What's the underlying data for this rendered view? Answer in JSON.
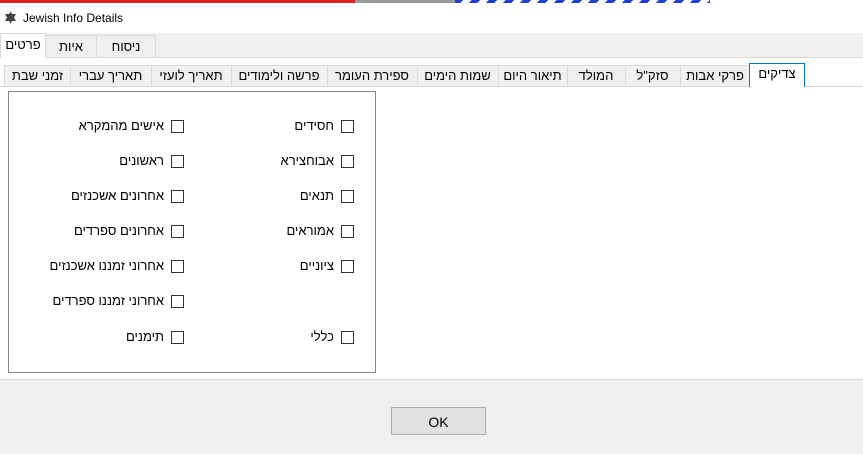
{
  "window": {
    "title": "Jewish Info Details",
    "icon": "star-of-david-icon"
  },
  "outer_tabs": [
    {
      "label": "פרטים",
      "active": true
    },
    {
      "label": "איות",
      "active": false
    },
    {
      "label": "ניסוח",
      "active": false
    }
  ],
  "inner_tabs": [
    {
      "label": "צדיקים",
      "active": true
    },
    {
      "label": "פרקי אבות",
      "active": false
    },
    {
      "label": "סזק\"ל",
      "active": false
    },
    {
      "label": "המולד",
      "active": false
    },
    {
      "label": "תיאור היום",
      "active": false
    },
    {
      "label": "שמות הימים",
      "active": false
    },
    {
      "label": "ספירת העומר",
      "active": false
    },
    {
      "label": "פרשה ולימודים",
      "active": false
    },
    {
      "label": "תאריך לועזי",
      "active": false
    },
    {
      "label": "תאריך עברי",
      "active": false
    },
    {
      "label": "זמני שבת",
      "active": false
    }
  ],
  "checkboxes_right": [
    {
      "label": "חסידים",
      "checked": false
    },
    {
      "label": "אבוחצירא",
      "checked": false
    },
    {
      "label": "תנאים",
      "checked": false
    },
    {
      "label": "אמוראים",
      "checked": false
    },
    {
      "label": "ציוניים",
      "checked": false
    },
    {
      "label": "כללי",
      "checked": false
    }
  ],
  "checkboxes_left": [
    {
      "label": "אישים מהמקרא",
      "checked": false
    },
    {
      "label": "ראשונים",
      "checked": false
    },
    {
      "label": "אחרונים אשכנזים",
      "checked": false
    },
    {
      "label": "אחרונים ספרדים",
      "checked": false
    },
    {
      "label": "אחרוני זמננו אשכנזים",
      "checked": false
    },
    {
      "label": "אחרוני זמננו ספרדים",
      "checked": false
    },
    {
      "label": "תימנים",
      "checked": false
    }
  ],
  "ok_label": "OK"
}
